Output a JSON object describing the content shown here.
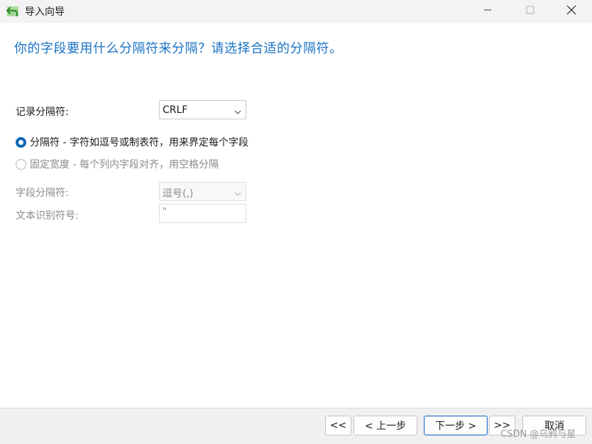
{
  "window": {
    "title": "导入向导",
    "icon": "arrow-back-icon",
    "controls": [
      "minimize-icon",
      "maximize-icon",
      "close-icon"
    ]
  },
  "heading": "你的字段要用什么分隔符来分隔？请选择合适的分隔符。",
  "record_delimiter": {
    "label": "记录分隔符:",
    "value": "CRLF"
  },
  "mode_options": [
    {
      "label": "分隔符 - 字符如逗号或制表符，用来界定每个字段",
      "checked": true
    },
    {
      "label": "固定宽度 - 每个列内字段对齐，用空格分隔",
      "checked": false
    }
  ],
  "field_delimiter": {
    "label": "字段分隔符:",
    "value": "逗号(,)"
  },
  "text_qualifier": {
    "label": "文本识别符号:",
    "value": "\""
  },
  "buttons": {
    "first": "<<",
    "back": "< 上一步",
    "next": "下一步 >",
    "last": ">>",
    "cancel": "取消"
  },
  "watermark": "CSDN @乌鸦与星",
  "colors": {
    "accent": "#1c73c4",
    "radio_checked": "#0a66b8",
    "titlebar": "#f3f3f3",
    "footer": "#f0f0f0"
  }
}
